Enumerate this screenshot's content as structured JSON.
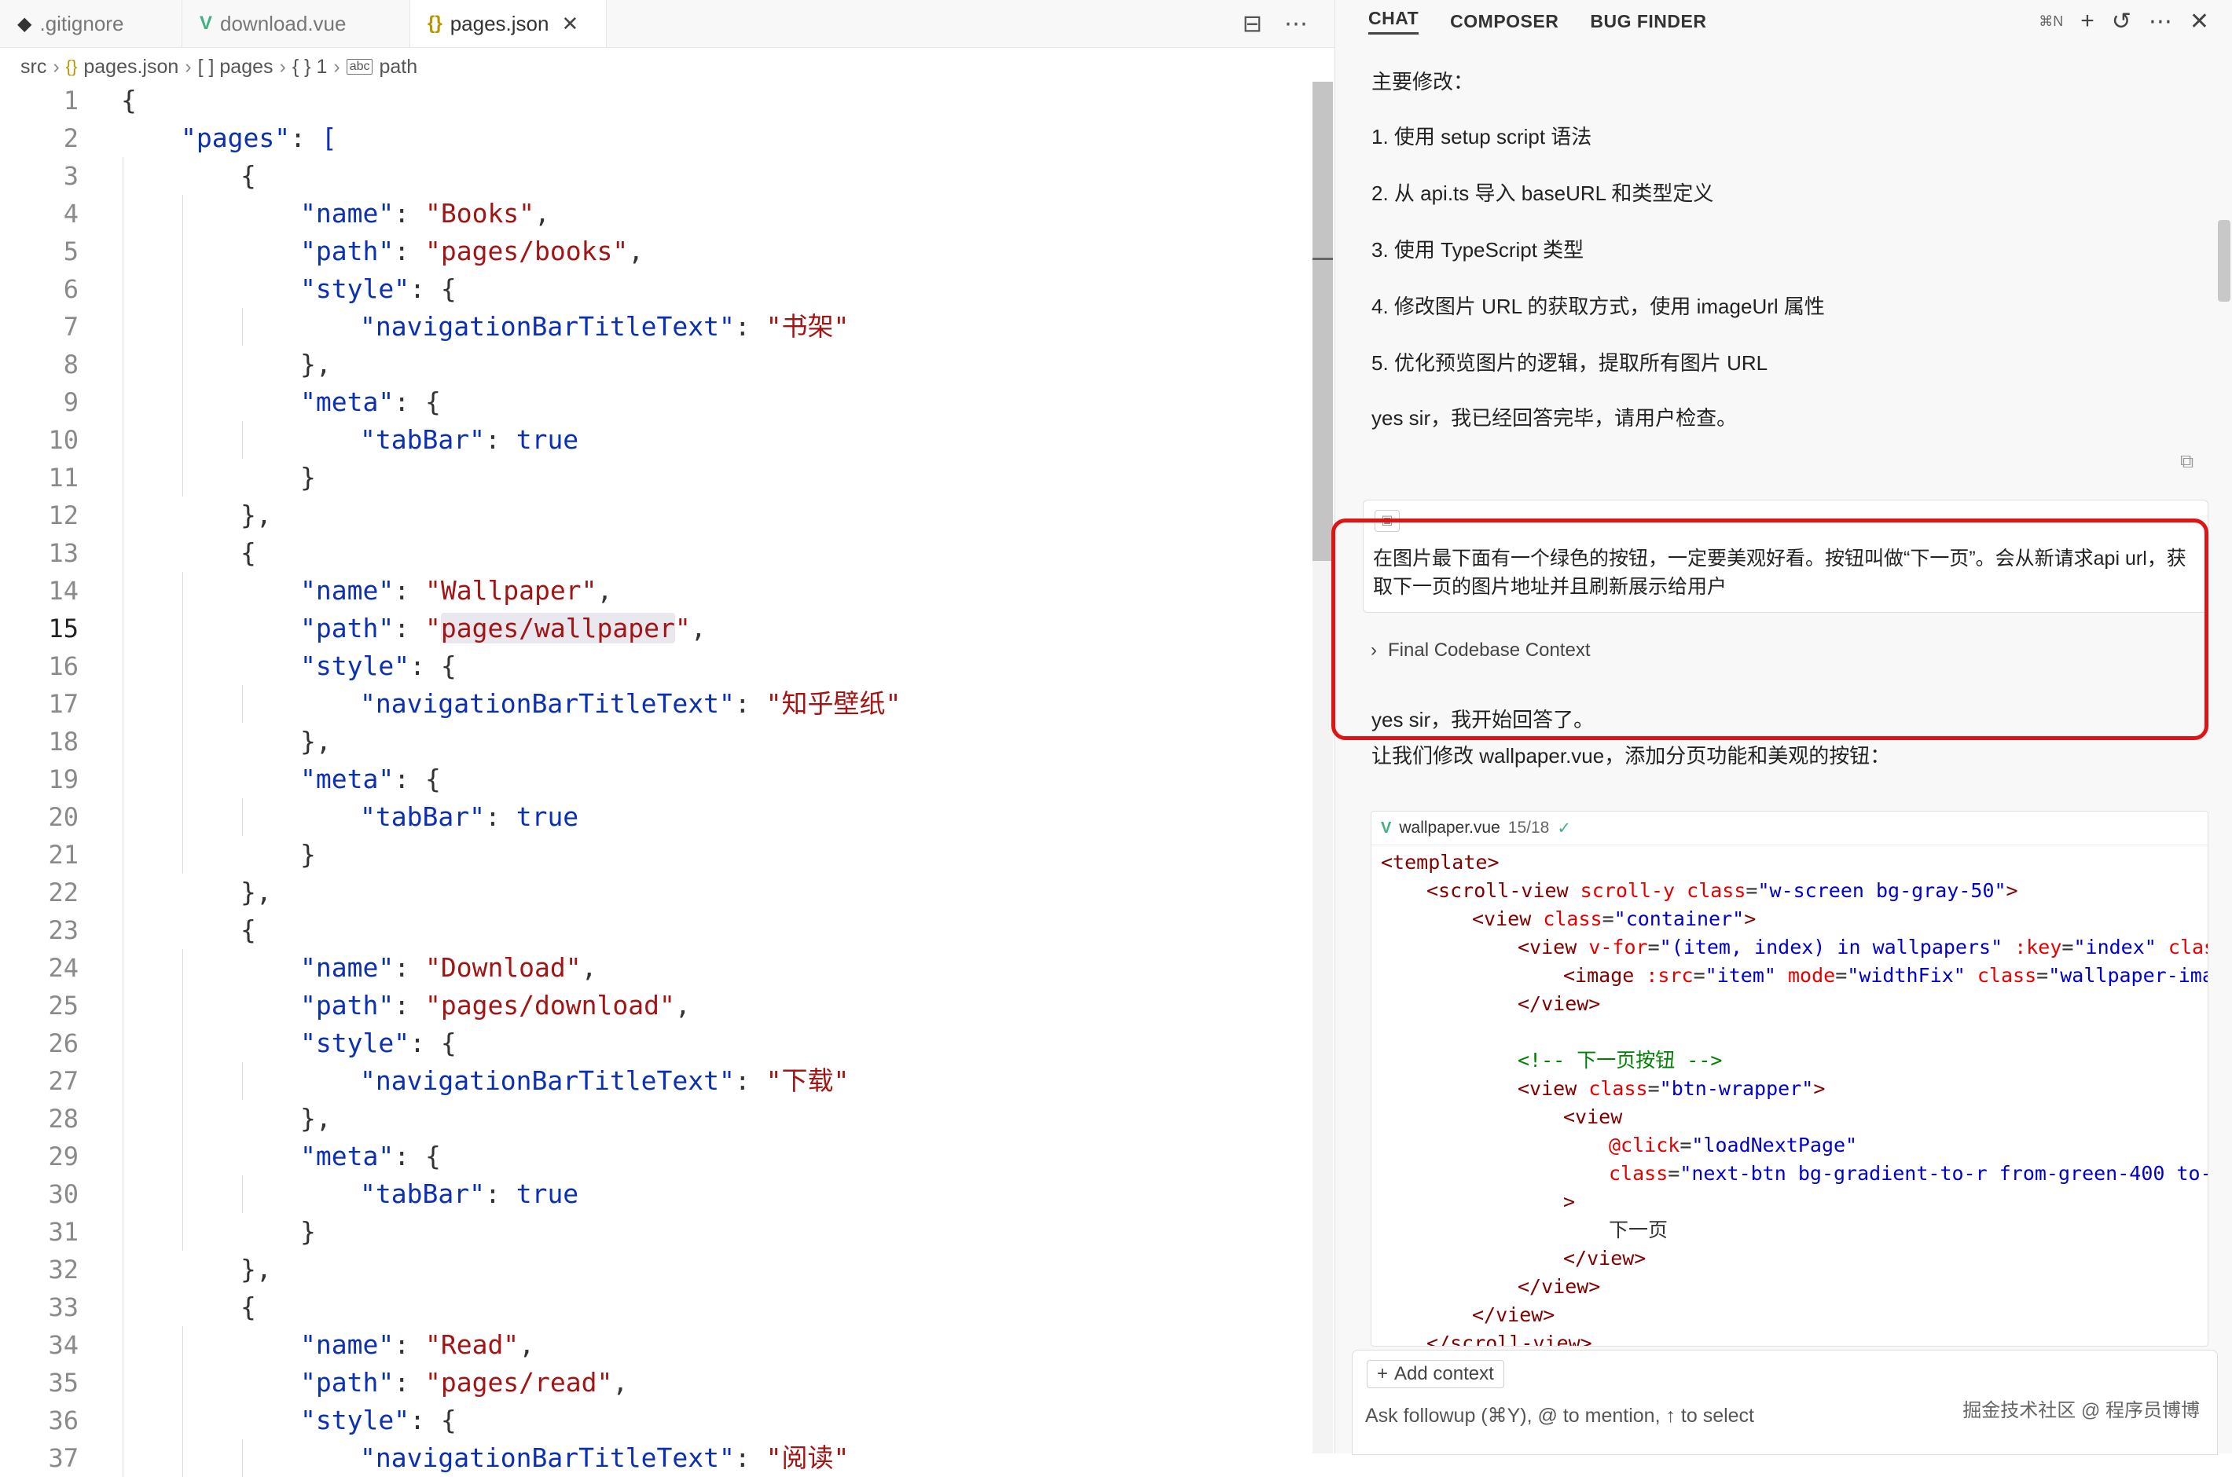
{
  "editor": {
    "tabs": [
      {
        "label": ".gitignore",
        "icon": "diamond-icon"
      },
      {
        "label": "download.vue",
        "icon": "vue-icon"
      },
      {
        "label": "pages.json",
        "icon": "braces-icon",
        "close": "✕"
      }
    ],
    "breadcrumb": [
      "src",
      "pages.json",
      "[ ] pages",
      "{ } 1",
      "path"
    ],
    "current_line": 15
  },
  "code_lines": [
    [
      [
        "p",
        "{"
      ]
    ],
    [
      [
        "k",
        "\"pages\""
      ],
      [
        "p",
        ": "
      ],
      [
        "bl",
        "["
      ]
    ],
    [
      [
        "p",
        "{"
      ]
    ],
    [
      [
        "k",
        "\"name\""
      ],
      [
        "p",
        ": "
      ],
      [
        "s",
        "\"Books\""
      ],
      [
        "p",
        ","
      ]
    ],
    [
      [
        "k",
        "\"path\""
      ],
      [
        "p",
        ": "
      ],
      [
        "s",
        "\"pages/books\""
      ],
      [
        "p",
        ","
      ]
    ],
    [
      [
        "k",
        "\"style\""
      ],
      [
        "p",
        ": {"
      ]
    ],
    [
      [
        "k",
        "\"navigationBarTitleText\""
      ],
      [
        "p",
        ": "
      ],
      [
        "s",
        "\"书架\""
      ]
    ],
    [
      [
        "p",
        "},"
      ]
    ],
    [
      [
        "k",
        "\"meta\""
      ],
      [
        "p",
        ": {"
      ]
    ],
    [
      [
        "k",
        "\"tabBar\""
      ],
      [
        "p",
        ": "
      ],
      [
        "bl",
        "true"
      ]
    ],
    [
      [
        "p",
        "}"
      ]
    ],
    [
      [
        "p",
        "},"
      ]
    ],
    [
      [
        "p",
        "{"
      ]
    ],
    [
      [
        "k",
        "\"name\""
      ],
      [
        "p",
        ": "
      ],
      [
        "s",
        "\"Wallpaper\""
      ],
      [
        "p",
        ","
      ]
    ],
    [
      [
        "k",
        "\"path\""
      ],
      [
        "p",
        ": "
      ],
      [
        "s",
        "\"pages/wallpaper\""
      ],
      [
        "p",
        ","
      ]
    ],
    [
      [
        "k",
        "\"style\""
      ],
      [
        "p",
        ": {"
      ]
    ],
    [
      [
        "k",
        "\"navigationBarTitleText\""
      ],
      [
        "p",
        ": "
      ],
      [
        "s",
        "\"知乎壁纸\""
      ]
    ],
    [
      [
        "p",
        "},"
      ]
    ],
    [
      [
        "k",
        "\"meta\""
      ],
      [
        "p",
        ": {"
      ]
    ],
    [
      [
        "k",
        "\"tabBar\""
      ],
      [
        "p",
        ": "
      ],
      [
        "bl",
        "true"
      ]
    ],
    [
      [
        "p",
        "}"
      ]
    ],
    [
      [
        "p",
        "},"
      ]
    ],
    [
      [
        "p",
        "{"
      ]
    ],
    [
      [
        "k",
        "\"name\""
      ],
      [
        "p",
        ": "
      ],
      [
        "s",
        "\"Download\""
      ],
      [
        "p",
        ","
      ]
    ],
    [
      [
        "k",
        "\"path\""
      ],
      [
        "p",
        ": "
      ],
      [
        "s",
        "\"pages/download\""
      ],
      [
        "p",
        ","
      ]
    ],
    [
      [
        "k",
        "\"style\""
      ],
      [
        "p",
        ": {"
      ]
    ],
    [
      [
        "k",
        "\"navigationBarTitleText\""
      ],
      [
        "p",
        ": "
      ],
      [
        "s",
        "\"下载\""
      ]
    ],
    [
      [
        "p",
        "},"
      ]
    ],
    [
      [
        "k",
        "\"meta\""
      ],
      [
        "p",
        ": {"
      ]
    ],
    [
      [
        "k",
        "\"tabBar\""
      ],
      [
        "p",
        ": "
      ],
      [
        "bl",
        "true"
      ]
    ],
    [
      [
        "p",
        "}"
      ]
    ],
    [
      [
        "p",
        "},"
      ]
    ],
    [
      [
        "p",
        "{"
      ]
    ],
    [
      [
        "k",
        "\"name\""
      ],
      [
        "p",
        ": "
      ],
      [
        "s",
        "\"Read\""
      ],
      [
        "p",
        ","
      ]
    ],
    [
      [
        "k",
        "\"path\""
      ],
      [
        "p",
        ": "
      ],
      [
        "s",
        "\"pages/read\""
      ],
      [
        "p",
        ","
      ]
    ],
    [
      [
        "k",
        "\"style\""
      ],
      [
        "p",
        ": {"
      ]
    ],
    [
      [
        "k",
        "\"navigationBarTitleText\""
      ],
      [
        "p",
        ": "
      ],
      [
        "s",
        "\"阅读\""
      ]
    ]
  ],
  "chat": {
    "tabs": [
      "CHAT",
      "COMPOSER",
      "BUG FINDER"
    ],
    "shortcut": "⌘N",
    "summary_title": "主要修改：",
    "summary_items": [
      "1. 使用 setup script 语法",
      "2. 从 api.ts 导入 baseURL 和类型定义",
      "3. 使用 TypeScript 类型",
      "4. 修改图片 URL 的获取方式，使用 imageUrl 属性",
      "5. 优化预览图片的逻辑，提取所有图片 URL"
    ],
    "done_text": "yes sir，我已经回答完毕，请用户检查。",
    "user_message": "在图片最下面有一个绿色的按钮，一定要美观好看。按钮叫做“下一页”。会从新请求api url，获取下一页的图片地址并且刷新展示给用户",
    "context_label": "Final Codebase Context",
    "start_text": "yes sir，我开始回答了。",
    "intro_text": "让我们修改 wallpaper.vue，添加分页功能和美观的按钮：",
    "codeblock": {
      "file": "wallpaper.vue",
      "count": "15/18",
      "lines": [
        {
          "indent": 0,
          "parts": [
            [
              "t",
              "<template>"
            ]
          ]
        },
        {
          "indent": 1,
          "parts": [
            [
              "t",
              "<scroll-view "
            ],
            [
              "a",
              "scroll-y "
            ],
            [
              "a",
              "class"
            ],
            [
              "p",
              "="
            ],
            [
              "v",
              "\"w-screen bg-gray-50\""
            ],
            [
              "t",
              ">"
            ]
          ]
        },
        {
          "indent": 2,
          "parts": [
            [
              "t",
              "<view "
            ],
            [
              "a",
              "class"
            ],
            [
              "p",
              "="
            ],
            [
              "v",
              "\"container\""
            ],
            [
              "t",
              ">"
            ]
          ]
        },
        {
          "indent": 3,
          "parts": [
            [
              "t",
              "<view "
            ],
            [
              "a",
              "v-for"
            ],
            [
              "p",
              "="
            ],
            [
              "v",
              "\"(item, index) in wallpapers\" "
            ],
            [
              "a",
              ":key"
            ],
            [
              "p",
              "="
            ],
            [
              "v",
              "\"index\" "
            ],
            [
              "a",
              "clas"
            ]
          ]
        },
        {
          "indent": 4,
          "parts": [
            [
              "t",
              "<image "
            ],
            [
              "a",
              ":src"
            ],
            [
              "p",
              "="
            ],
            [
              "v",
              "\"item\" "
            ],
            [
              "a",
              "mode"
            ],
            [
              "p",
              "="
            ],
            [
              "v",
              "\"widthFix\" "
            ],
            [
              "a",
              "class"
            ],
            [
              "p",
              "="
            ],
            [
              "v",
              "\"wallpaper-ima"
            ]
          ]
        },
        {
          "indent": 3,
          "parts": [
            [
              "t",
              "</view>"
            ]
          ]
        },
        {
          "indent": 0,
          "parts": [
            [
              "p",
              ""
            ]
          ]
        },
        {
          "indent": 3,
          "parts": [
            [
              "c",
              "<!-- 下一页按钮 -->"
            ]
          ]
        },
        {
          "indent": 3,
          "parts": [
            [
              "t",
              "<view "
            ],
            [
              "a",
              "class"
            ],
            [
              "p",
              "="
            ],
            [
              "v",
              "\"btn-wrapper\""
            ],
            [
              "t",
              ">"
            ]
          ]
        },
        {
          "indent": 4,
          "parts": [
            [
              "t",
              "<view"
            ]
          ]
        },
        {
          "indent": 5,
          "parts": [
            [
              "a",
              "@click"
            ],
            [
              "p",
              "="
            ],
            [
              "v",
              "\"loadNextPage\""
            ]
          ]
        },
        {
          "indent": 5,
          "parts": [
            [
              "a",
              "class"
            ],
            [
              "p",
              "="
            ],
            [
              "v",
              "\"next-btn bg-gradient-to-r from-green-400 to-"
            ]
          ]
        },
        {
          "indent": 4,
          "parts": [
            [
              "t",
              ">"
            ]
          ]
        },
        {
          "indent": 5,
          "parts": [
            [
              "p",
              "下一页"
            ]
          ]
        },
        {
          "indent": 4,
          "parts": [
            [
              "t",
              "</view>"
            ]
          ]
        },
        {
          "indent": 3,
          "parts": [
            [
              "t",
              "</view>"
            ]
          ]
        },
        {
          "indent": 2,
          "parts": [
            [
              "t",
              "</view>"
            ]
          ]
        },
        {
          "indent": 1,
          "parts": [
            [
              "t",
              "</scroll-view>"
            ]
          ]
        }
      ]
    },
    "add_context_label": "Add context",
    "input_placeholder": "Ask followup (⌘Y), @ to mention, ↑ to select",
    "watermark": "掘金技术社区 @ 程序员博博"
  },
  "colors": {
    "keyword": "#0b2fb5",
    "string": "#a31515",
    "highlight_box": "#e01414",
    "vue_green": "#3fb27f"
  }
}
